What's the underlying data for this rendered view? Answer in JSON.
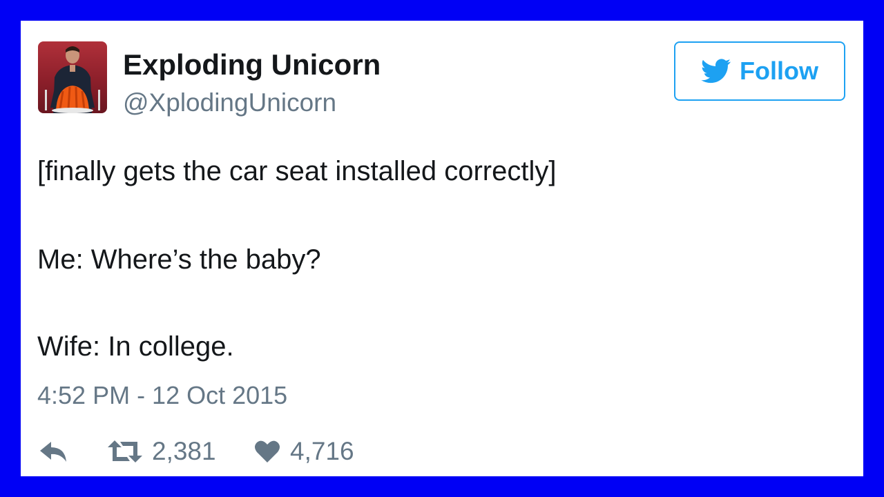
{
  "author": {
    "display_name": "Exploding Unicorn",
    "handle": "@XplodingUnicorn"
  },
  "follow_button": {
    "label": "Follow",
    "icon": "twitter-bird-icon"
  },
  "tweet": {
    "lines": [
      "[finally gets the car seat installed correctly]",
      "Me: Where’s the baby?",
      "Wife: In college."
    ],
    "timestamp": "4:52 PM - 12 Oct 2015"
  },
  "actions": {
    "reply_icon": "reply-icon",
    "retweet_icon": "retweet-icon",
    "retweet_count": "2,381",
    "like_icon": "heart-icon",
    "like_count": "4,716"
  },
  "colors": {
    "frame": "#0000f5",
    "card": "#ffffff",
    "text": "#14171a",
    "secondary": "#657786",
    "twitter_blue": "#1da1f2"
  }
}
